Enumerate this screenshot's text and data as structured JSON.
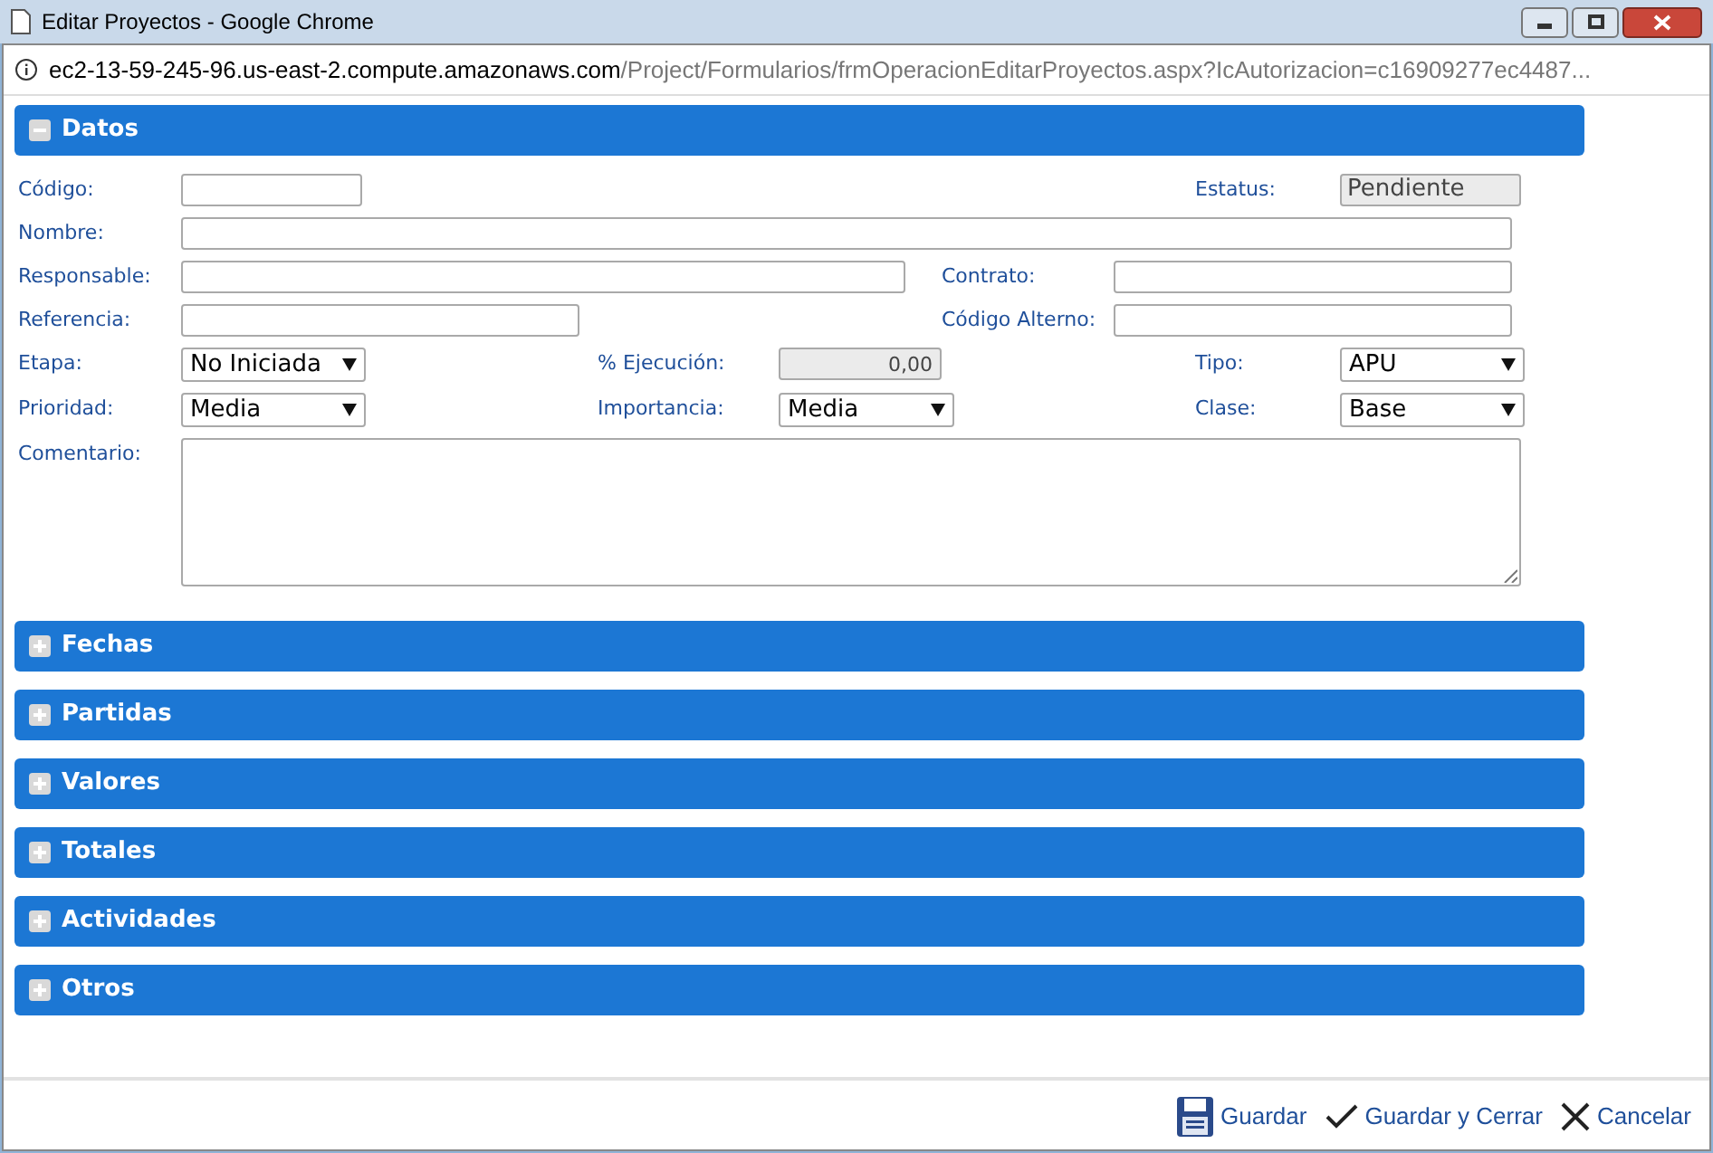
{
  "window": {
    "title": "Editar Proyectos - Google Chrome"
  },
  "address_bar": {
    "host": "ec2-13-59-245-96.us-east-2.compute.amazonaws.com",
    "path": "/Project/Formularios/frmOperacionEditarProyectos.aspx?IcAutorizacion=c16909277ec4487..."
  },
  "sections": [
    {
      "title": "Datos",
      "expanded": true
    },
    {
      "title": "Fechas",
      "expanded": false
    },
    {
      "title": "Partidas",
      "expanded": false
    },
    {
      "title": "Valores",
      "expanded": false
    },
    {
      "title": "Totales",
      "expanded": false
    },
    {
      "title": "Actividades",
      "expanded": false
    },
    {
      "title": "Otros",
      "expanded": false
    }
  ],
  "form_rows": [
    [
      {
        "label": "Código:",
        "kind": "text"
      },
      {
        "label": "Estatus:",
        "kind": "readonly",
        "value": "Pendiente"
      }
    ],
    [
      {
        "label": "Nombre:",
        "kind": "text"
      }
    ],
    [
      {
        "label": "Responsable:",
        "kind": "text"
      },
      {
        "label": "Contrato:",
        "kind": "text"
      }
    ],
    [
      {
        "label": "Referencia:",
        "kind": "text"
      },
      {
        "label": "Código Alterno:",
        "kind": "text"
      }
    ],
    [
      {
        "label": "Etapa:",
        "kind": "select",
        "value": "No Iniciada"
      },
      {
        "label": "% Ejecución:",
        "kind": "number",
        "value": "0,00"
      },
      {
        "label": "Tipo:",
        "kind": "select",
        "value": "APU"
      }
    ],
    [
      {
        "label": "Prioridad:",
        "kind": "select",
        "value": "Media"
      },
      {
        "label": "Importancia:",
        "kind": "select",
        "value": "Media"
      },
      {
        "label": "Clase:",
        "kind": "select",
        "value": "Base"
      }
    ],
    [
      {
        "label": "Comentario:",
        "kind": "textarea"
      }
    ]
  ],
  "footer_buttons": [
    {
      "label": "Guardar",
      "kind": "save"
    },
    {
      "label": "Guardar y Cerrar",
      "kind": "check"
    },
    {
      "label": "Cancelar",
      "kind": "close"
    }
  ]
}
